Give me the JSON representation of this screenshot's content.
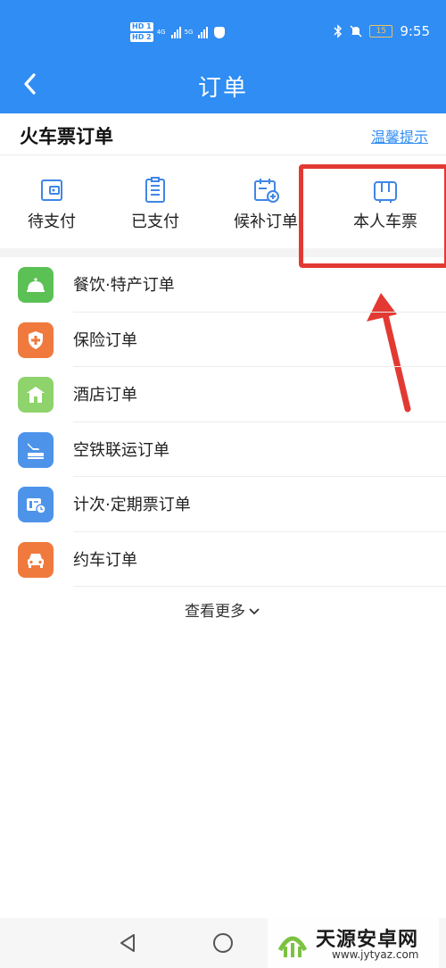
{
  "status_bar": {
    "hd1": "HD 1",
    "hd2": "HD 2",
    "net1": "4G",
    "net2": "5G",
    "battery": "15",
    "time": "9:55"
  },
  "nav": {
    "title": "订单",
    "back_icon": "back-arrow-icon"
  },
  "section": {
    "title": "火车票订单",
    "tip_link": "温馨提示"
  },
  "tabs": [
    {
      "label": "待支付",
      "icon": "wallet-icon"
    },
    {
      "label": "已支付",
      "icon": "clipboard-icon"
    },
    {
      "label": "候补订单",
      "icon": "calendar-add-icon"
    },
    {
      "label": "本人车票",
      "icon": "suitcase-icon"
    }
  ],
  "list": [
    {
      "label": "餐饮·特产订单",
      "icon": "food-bell-icon",
      "color": "#5cc155"
    },
    {
      "label": "保险订单",
      "icon": "shield-plus-icon",
      "color": "#f07a3e"
    },
    {
      "label": "酒店订单",
      "icon": "hotel-icon",
      "color": "#8ed36b"
    },
    {
      "label": "空铁联运订单",
      "icon": "plane-train-icon",
      "color": "#4d93ea"
    },
    {
      "label": "计次·定期票订单",
      "icon": "ticket-clock-icon",
      "color": "#4d93ea"
    },
    {
      "label": "约车订单",
      "icon": "car-icon",
      "color": "#f07a3e"
    }
  ],
  "more": {
    "label": "查看更多"
  },
  "annotation_color": "#e23a33",
  "accent_color": "#2f8df3",
  "watermark": {
    "title": "天源安卓网",
    "url": "www.jytyaz.com"
  }
}
